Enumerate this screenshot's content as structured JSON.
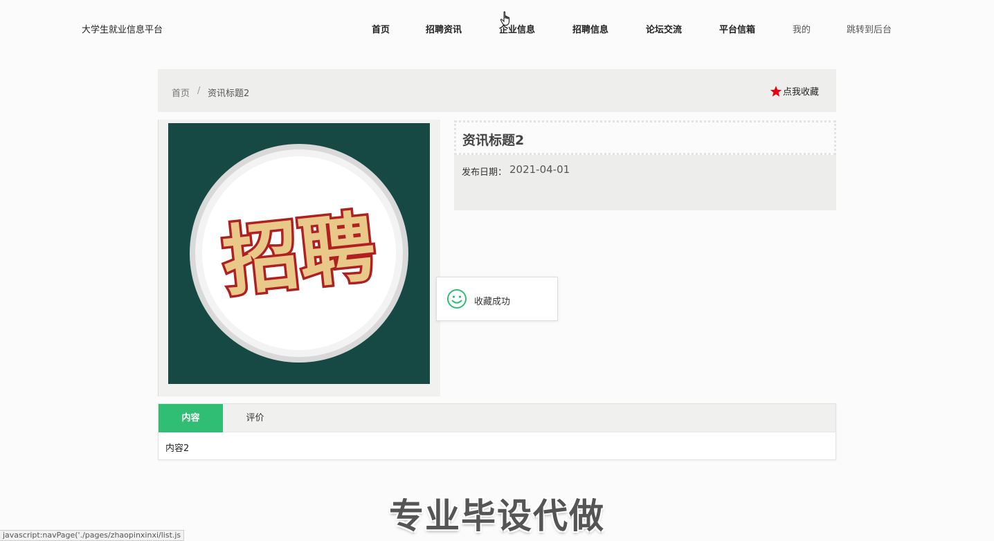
{
  "app": {
    "brand": "大学生就业信息平台"
  },
  "nav": {
    "items": [
      "首页",
      "招聘资讯",
      "企业信息",
      "招聘信息",
      "论坛交流",
      "平台信箱",
      "我的",
      "跳转到后台"
    ]
  },
  "breadcrumb": {
    "home": "首页",
    "separator": "/",
    "current": "资讯标题2"
  },
  "favorite": {
    "label": "点我收藏",
    "icon": "star-icon",
    "icon_color": "#e60012"
  },
  "article": {
    "title": "资讯标题2",
    "date_label": "发布日期：",
    "date_value": "2021-04-01",
    "image_text": "招聘"
  },
  "toast": {
    "icon": "smile-icon",
    "message": "收藏成功",
    "icon_color": "#2fbe74"
  },
  "tabs": {
    "items": [
      "内容",
      "评价"
    ],
    "active_index": 0,
    "content": "内容2",
    "accent_color": "#2fbe74"
  },
  "overlay": {
    "watermark": "专业毕设代做"
  },
  "status_bar": {
    "url": "javascript:navPage('./pages/zhaopinxinxi/list.js"
  }
}
